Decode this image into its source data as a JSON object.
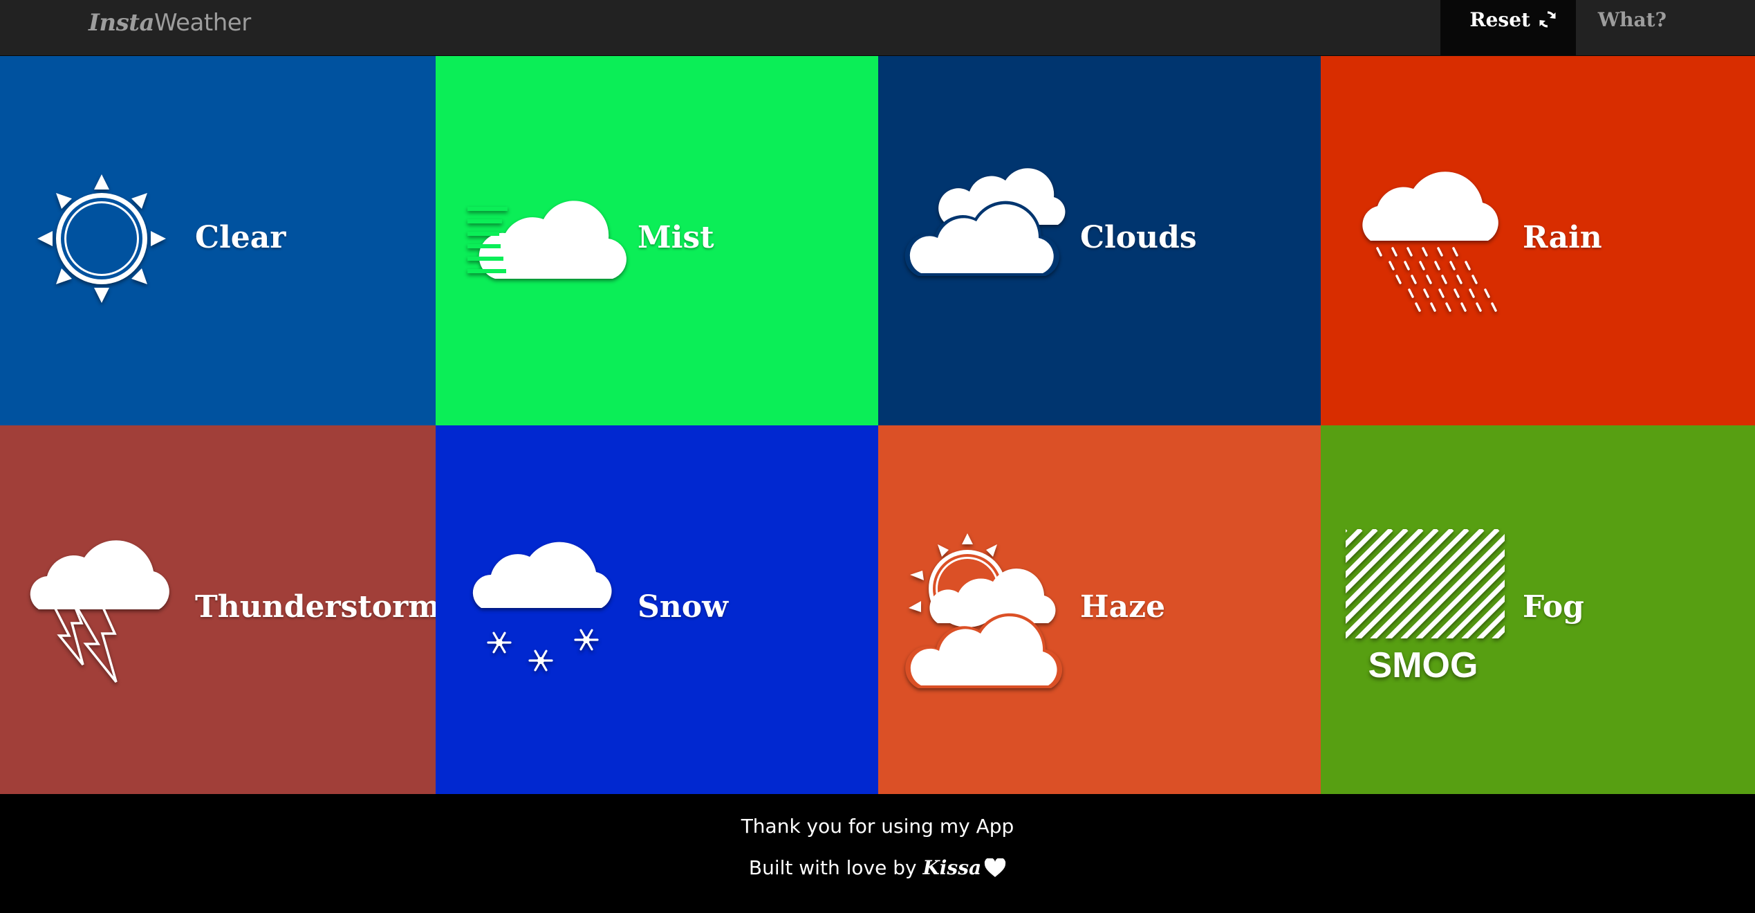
{
  "navbar": {
    "brand_part1": "Insta",
    "brand_part2": "Weather",
    "reset_label": "Reset",
    "reset_icon": "refresh-icon",
    "what_label": "What?"
  },
  "tiles": [
    {
      "label": "Clear",
      "icon": "sun-icon",
      "color": "#00529f"
    },
    {
      "label": "Mist",
      "icon": "mist-cloud-icon",
      "color": "#0bee57"
    },
    {
      "label": "Clouds",
      "icon": "clouds-icon",
      "color": "#00356f"
    },
    {
      "label": "Rain",
      "icon": "rain-icon",
      "color": "#d82d00"
    },
    {
      "label": "Thunderstorm",
      "icon": "thunderstorm-icon",
      "color": "#a13f39"
    },
    {
      "label": "Snow",
      "icon": "snow-icon",
      "color": "#0128d0"
    },
    {
      "label": "Haze",
      "icon": "haze-icon",
      "color": "#db5026"
    },
    {
      "label": "Fog",
      "icon": "smog-icon",
      "color": "#579f12",
      "icon_text": "SMOG"
    }
  ],
  "footer": {
    "line1": "Thank you for using my App",
    "line2_prefix": "Built with love by",
    "author": "Kissa",
    "heart_icon": "heart-icon"
  }
}
